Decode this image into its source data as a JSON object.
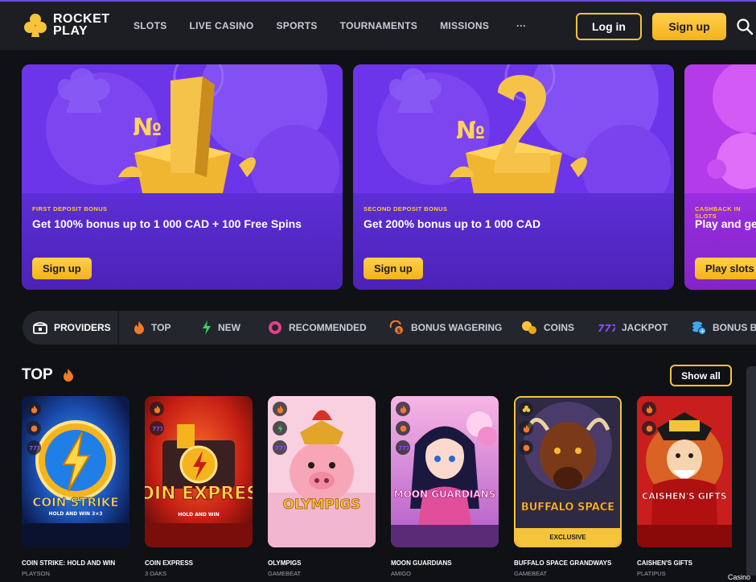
{
  "header": {
    "logo_line1": "ROCKET",
    "logo_line2": "PLAY",
    "nav": [
      "SLOTS",
      "LIVE CASINO",
      "SPORTS",
      "TOURNAMENTS",
      "MISSIONS"
    ],
    "nav_more": "···",
    "login_label": "Log in",
    "signup_label": "Sign up",
    "accent": "#f6c33a"
  },
  "banners": [
    {
      "tag": "FIRST DEPOSIT BONUS",
      "title": "Get 100% bonus up to 1 000 CAD + 100 Free Spins",
      "button": "Sign up",
      "art_number": "1"
    },
    {
      "tag": "SECOND DEPOSIT BONUS",
      "title": "Get 200% bonus up to 1 000 CAD",
      "button": "Sign up",
      "art_number": "2"
    },
    {
      "tag": "CASHBACK IN SLOTS",
      "title": "Play and get",
      "button": "Play slots"
    }
  ],
  "categories": {
    "providers": "PROVIDERS",
    "items": [
      "TOP",
      "NEW",
      "RECOMMENDED",
      "BONUS WAGERING",
      "COINS",
      "JACKPOT",
      "BONUS BUY"
    ]
  },
  "section": {
    "title": "TOP",
    "show_all": "Show all"
  },
  "games": [
    {
      "name": "COIN STRIKE: HOLD AND WIN",
      "provider": "PLAYSON",
      "art": "COIN STRIKE",
      "art_sub": "HOLD AND WIN 3×3"
    },
    {
      "name": "COIN EXPRESS",
      "provider": "3 OAKS",
      "art": "COIN EXPRESS",
      "art_sub": "HOLD AND WIN"
    },
    {
      "name": "OLYMPIGS",
      "provider": "GAMEBEAT",
      "art": "OLYMPIGS"
    },
    {
      "name": "MOON GUARDIANS",
      "provider": "AMIGO",
      "art": "MOON GUARDIANS"
    },
    {
      "name": "BUFFALO SPACE GRANDWAYS",
      "provider": "GAMEBEAT",
      "art": "BUFFALO SPACE",
      "badge": "EXCLUSIVE"
    },
    {
      "name": "CAISHEN'S GIFTS",
      "provider": "PLATIPUS",
      "art": "CAISHEN'S GIFTS"
    }
  ],
  "footer_label": "Casino"
}
